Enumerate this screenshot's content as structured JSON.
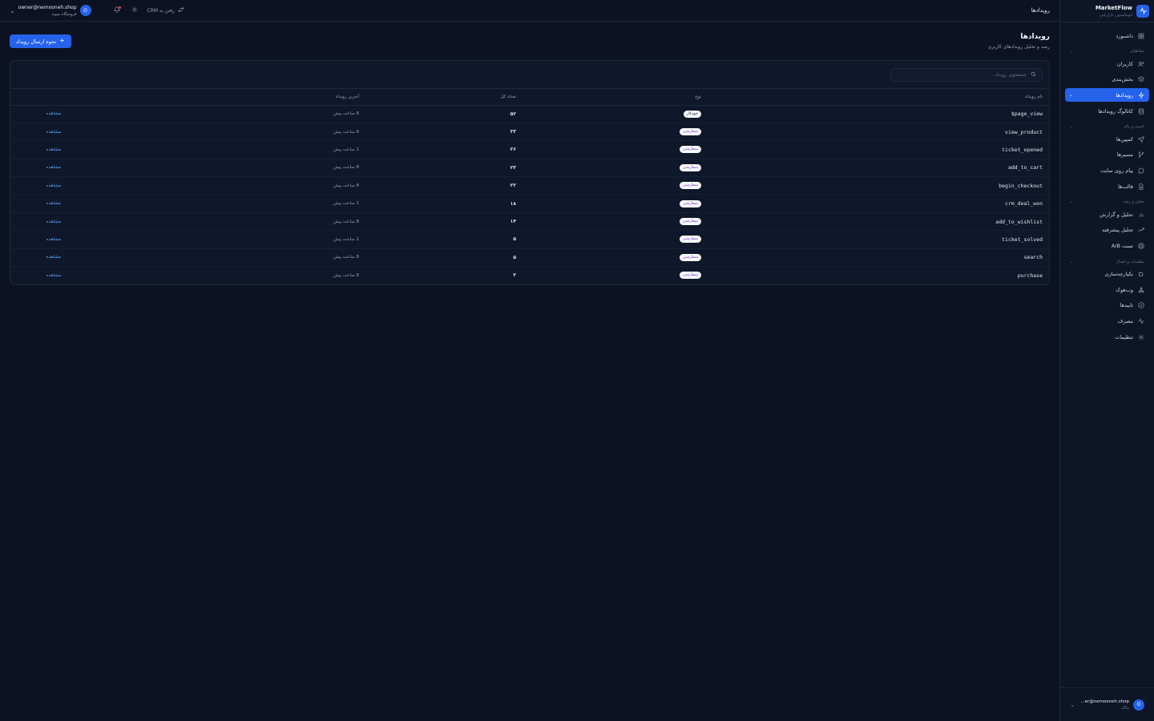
{
  "brand": {
    "name": "MarketFlow",
    "subtitle": "اتوماسیون بازاریابی"
  },
  "sidebar": {
    "dashboard": "داشبورد",
    "sections": [
      {
        "label": "مخاطبان",
        "items": [
          "کاربران",
          "بخش‌بندی",
          "رویدادها",
          "کاتالوگ رویدادها"
        ]
      },
      {
        "label": "کمپین و پیام",
        "items": [
          "کمپین‌ها",
          "مسیرها",
          "پیام روی سایت",
          "قالب‌ها"
        ]
      },
      {
        "label": "تحلیل و رشد",
        "items": [
          "تحلیل و گزارش",
          "تحلیل پیشرفته",
          "تست A/B"
        ]
      },
      {
        "label": "تنظیمات و اتصال",
        "items": [
          "یکپارچه‌سازی",
          "وب‌هوک",
          "تاییدها",
          "مصرف",
          "تنظیمات"
        ]
      }
    ],
    "footer": {
      "avatar": "O",
      "email": "...er@nemooneh.shop",
      "role": "مالک"
    }
  },
  "topbar": {
    "title": "رویدادها",
    "crm_link": "رفتن به CRM",
    "user": {
      "avatar": "O",
      "email": "owner@nemooneh.shop",
      "shop": "فروشگاه نمونه"
    }
  },
  "page": {
    "title": "رویدادها",
    "subtitle": "رصد و تحلیل رویدادهای کاربری",
    "send_button": "نحوه ارسال رویداد"
  },
  "search": {
    "placeholder": "جستجوی رویداد..."
  },
  "table": {
    "headers": {
      "name": "نام رویداد",
      "type": "نوع",
      "count": "تعداد کل",
      "last": "آخرین رویداد"
    },
    "view_label": "مشاهده",
    "rows": [
      {
        "name": "$page_view",
        "type": "خودکار",
        "count": "۵۲",
        "last": "8 ساعت پیش"
      },
      {
        "name": "view_product",
        "type": "سفارشی",
        "count": "۳۳",
        "last": "8 ساعت پیش"
      },
      {
        "name": "ticket_opened",
        "type": "سفارشی",
        "count": "۲۶",
        "last": "1 ساعت پیش"
      },
      {
        "name": "add_to_cart",
        "type": "سفارشی",
        "count": "۲۳",
        "last": "8 ساعت پیش"
      },
      {
        "name": "begin_checkout",
        "type": "سفارشی",
        "count": "۲۲",
        "last": "8 ساعت پیش"
      },
      {
        "name": "crm_deal_won",
        "type": "سفارشی",
        "count": "۱۸",
        "last": "1 ساعت پیش"
      },
      {
        "name": "add_to_wishlist",
        "type": "سفارشی",
        "count": "۱۴",
        "last": "8 ساعت پیش"
      },
      {
        "name": "ticket_solved",
        "type": "سفارشی",
        "count": "۵",
        "last": "1 ساعت پیش"
      },
      {
        "name": "search",
        "type": "سفارشی",
        "count": "۵",
        "last": "8 ساعت پیش"
      },
      {
        "name": "purchase",
        "type": "سفارشی",
        "count": "۲",
        "last": "8 ساعت پیش"
      }
    ]
  },
  "colors": {
    "accent": "#2563eb",
    "background": "#0c1222",
    "link": "#60a5fa",
    "badge_custom": "#7c3aed"
  }
}
